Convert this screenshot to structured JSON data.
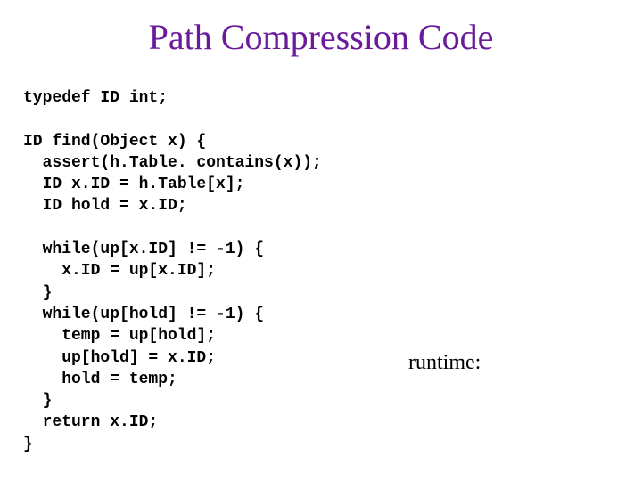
{
  "title": "Path Compression Code",
  "code": "typedef ID int;\n\nID find(Object x) {\n  assert(h.Table. contains(x));\n  ID x.ID = h.Table[x];\n  ID hold = x.ID;\n\n  while(up[x.ID] != -1) {\n    x.ID = up[x.ID];\n  }\n  while(up[hold] != -1) {\n    temp = up[hold];\n    up[hold] = x.ID;\n    hold = temp;\n  }\n  return x.ID;\n}",
  "runtime_label": "runtime:"
}
